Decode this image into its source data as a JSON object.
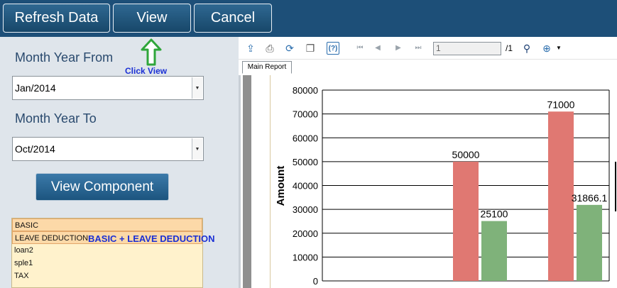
{
  "toolbar": {
    "refresh_label": "Refresh Data",
    "view_label": "View",
    "cancel_label": "Cancel"
  },
  "annotations": {
    "click_view": "Click View",
    "component_note": "BASIC + LEAVE DEDUCTION"
  },
  "filters": {
    "from_label": "Month Year From",
    "from_value": "Jan/2014",
    "to_label": "Month Year To",
    "to_value": "Oct/2014",
    "view_component_label": "View Component"
  },
  "components": [
    {
      "label": "BASIC",
      "selected": true
    },
    {
      "label": "LEAVE DEDUCTION",
      "selected": true
    },
    {
      "label": "loan2",
      "selected": false
    },
    {
      "label": "sple1",
      "selected": false
    },
    {
      "label": "TAX",
      "selected": false
    }
  ],
  "viewer": {
    "page_value": "1",
    "page_total": "/1",
    "tab_label": "Main Report",
    "icons": [
      "export-icon",
      "print-icon",
      "refresh-icon",
      "copy-icon",
      "help-icon",
      "first-page-icon",
      "prev-page-icon",
      "next-page-icon",
      "last-page-icon",
      "binoculars-icon",
      "zoom-icon"
    ]
  },
  "chart_data": {
    "type": "bar",
    "ylabel": "Amount",
    "ylim": [
      0,
      80000
    ],
    "yticks": [
      "80000",
      "70000",
      "60000",
      "50000",
      "40000",
      "30000",
      "20000",
      "10000",
      "0"
    ],
    "series": [
      {
        "color": "#e07872",
        "values": [
          50000,
          71000
        ],
        "labels": [
          "50000",
          "71000"
        ]
      },
      {
        "color": "#7fb27a",
        "values": [
          25100,
          31866.1
        ],
        "labels": [
          "25100",
          "31866.1"
        ]
      }
    ],
    "grid": true
  }
}
